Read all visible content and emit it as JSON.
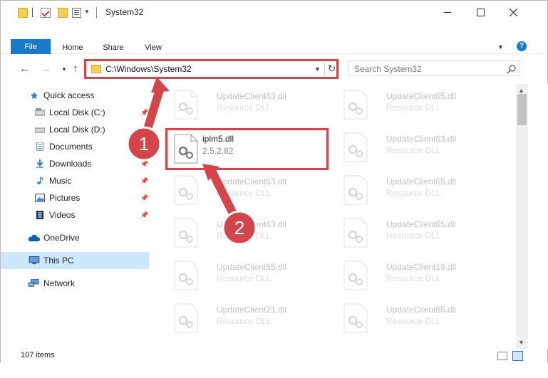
{
  "window": {
    "title": "System32"
  },
  "ribbon": {
    "tabs": [
      "File",
      "Home",
      "Share",
      "View"
    ]
  },
  "address": {
    "path": "C:\\Windows\\System32"
  },
  "search": {
    "placeholder": "Search System32"
  },
  "navpane": {
    "items": [
      {
        "label": "Quick access",
        "icon": "star-icon",
        "pinned": false
      },
      {
        "label": "Local Disk (C:)",
        "icon": "drive-icon",
        "pinned": true
      },
      {
        "label": "Local Disk (D:)",
        "icon": "drive-icon",
        "pinned": true
      },
      {
        "label": "Documents",
        "icon": "documents-icon",
        "pinned": true
      },
      {
        "label": "Downloads",
        "icon": "download-arrow-icon",
        "pinned": true
      },
      {
        "label": "Music",
        "icon": "music-note-icon",
        "pinned": true
      },
      {
        "label": "Pictures",
        "icon": "pictures-icon",
        "pinned": true
      },
      {
        "label": "Videos",
        "icon": "film-icon",
        "pinned": true
      },
      {
        "label": "OneDrive",
        "icon": "cloud-icon",
        "pinned": false
      },
      {
        "label": "This PC",
        "icon": "monitor-icon",
        "pinned": false,
        "selected": true
      },
      {
        "label": "Network",
        "icon": "network-icon",
        "pinned": false
      }
    ]
  },
  "files": {
    "left": [
      {
        "name": "UpdateClient63.dll",
        "desc": "Resource DLL"
      },
      {
        "name": "iplm5.dll",
        "desc": "2.5.2.82",
        "highlighted": true
      },
      {
        "name": "UpdateClient63.dll",
        "desc": "Resource DLL"
      },
      {
        "name": "UpdateClient63.dll",
        "desc": "Resource DLL"
      },
      {
        "name": "UpdateClient65.dll",
        "desc": "Resource DLL"
      },
      {
        "name": "UpdateClient21.dll",
        "desc": "Resource DLL"
      }
    ],
    "right": [
      {
        "name": "UpdateClient65.dll",
        "desc": "Resource DLL"
      },
      {
        "name": "UpdateClient63.dll",
        "desc": "Resource DLL"
      },
      {
        "name": "UpdateClient65.dll",
        "desc": "Resource DLL"
      },
      {
        "name": "UpdateClient65.dll",
        "desc": "Resource DLL"
      },
      {
        "name": "UpdateClient19.dll",
        "desc": "Resource DLL"
      },
      {
        "name": "UpdateClient65.dll",
        "desc": "Resource DLL"
      }
    ]
  },
  "status": {
    "count": "107 items"
  },
  "callouts": [
    "1",
    "2"
  ],
  "colors": {
    "accent": "#1979ca",
    "highlight": "#d3454b",
    "selected_bg": "#cce8ff"
  }
}
